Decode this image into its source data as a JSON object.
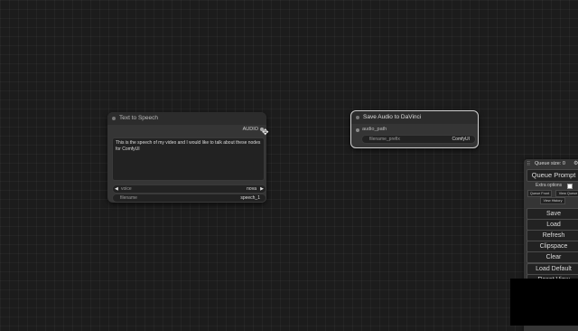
{
  "tts_node": {
    "title": "Text to Speech",
    "output_label": "AUDIO",
    "text": "This is the speech of my video and I would like to talk about these nodes for ComfyUI",
    "voice_label": "voice",
    "voice_value": "nova",
    "filename_label": "filename",
    "filename_value": "speech_1"
  },
  "davinci_node": {
    "title": "Save Audio to DaVinci",
    "input_label": "audio_path",
    "prefix_label": "filename_prefix",
    "prefix_value": "ComfyUI"
  },
  "menu": {
    "queue_size": "Queue size: 0",
    "queue_prompt": "Queue Prompt",
    "extra_options": "Extra options",
    "queue_front": "Queue Front",
    "view_queue": "View Queue",
    "view_history": "View History",
    "buttons": [
      "Save",
      "Load",
      "Refresh",
      "Clipspace",
      "Clear",
      "Load Default",
      "Reset View"
    ]
  },
  "colors": {
    "canvas": "#1c1c1c",
    "node_body": "#353535",
    "selected_border": "#cfcfcf"
  }
}
